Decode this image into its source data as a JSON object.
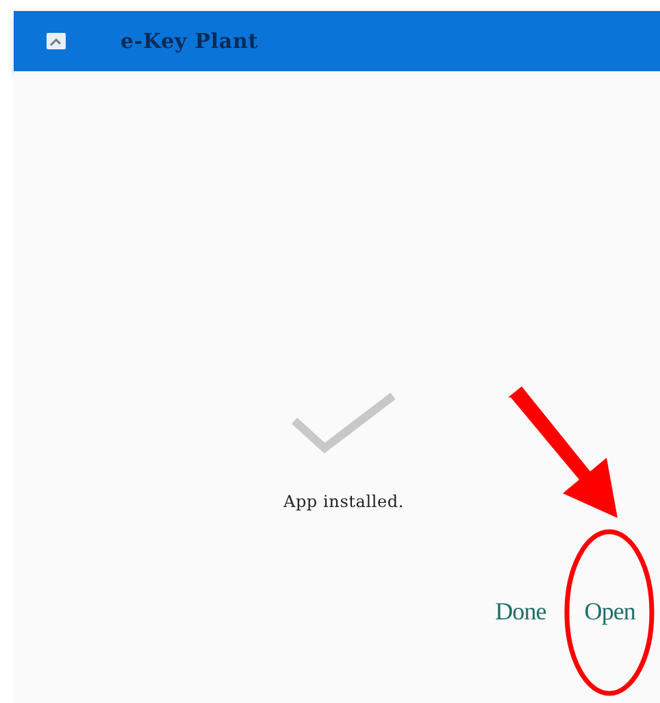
{
  "app_bar": {
    "title": "e-Key Plant"
  },
  "status": {
    "message": "App installed."
  },
  "buttons": [
    {
      "label": "Done"
    },
    {
      "label": "Open"
    }
  ],
  "annotations": [
    {
      "kind": "arrow"
    },
    {
      "kind": "ellipse"
    }
  ]
}
